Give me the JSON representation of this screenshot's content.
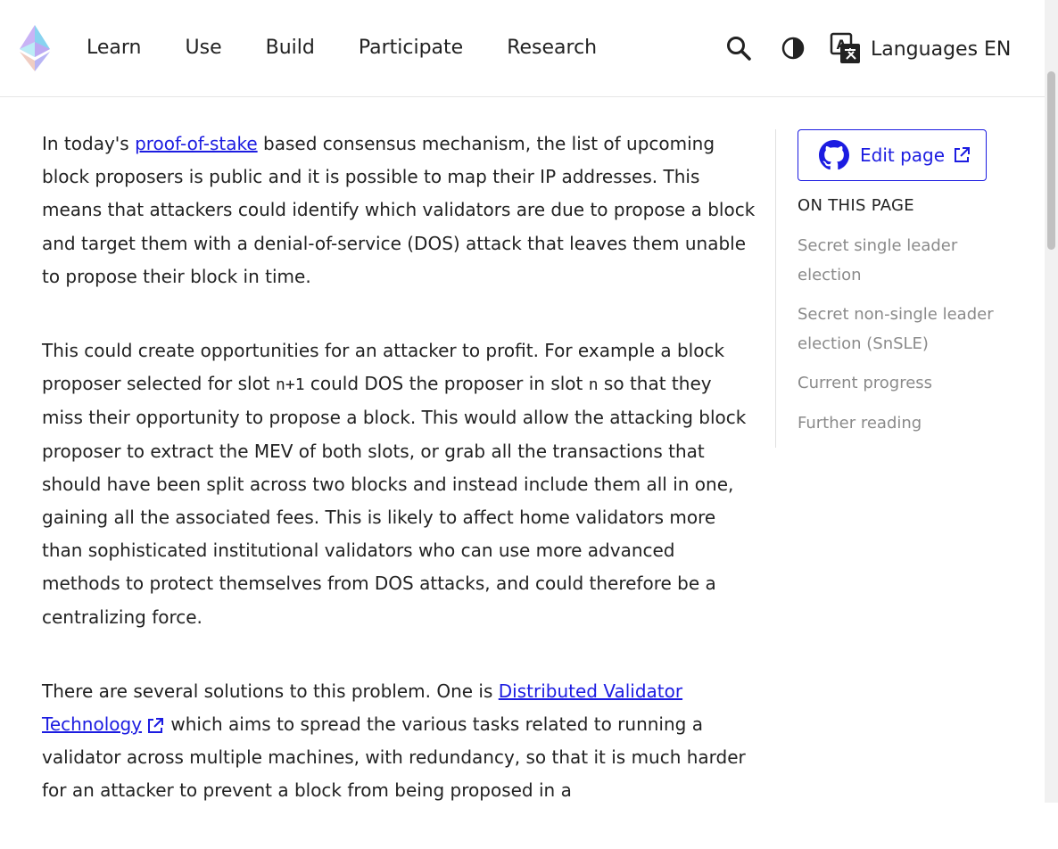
{
  "header": {
    "nav": [
      "Learn",
      "Use",
      "Build",
      "Participate",
      "Research"
    ],
    "icons": {
      "logo": "ethereum-logo",
      "search": "search-icon",
      "theme": "half-moon-icon",
      "language": "translate-icon"
    },
    "language_label": "Languages EN"
  },
  "content": {
    "p1": {
      "before": "In today's ",
      "link": "proof-of-stake",
      "after": " based consensus mechanism, the list of upcoming block proposers is public and it is possible to map their IP addresses. This means that attackers could identify which validators are due to propose a block and target them with a denial-of-service (DOS) attack that leaves them unable to propose their block in time."
    },
    "p2": {
      "part1": "This could create opportunities for an attacker to profit. For example a block proposer selected for slot ",
      "code1": "n+1",
      "part2": " could DOS the proposer in slot ",
      "code2": "n",
      "part3": " so that they miss their opportunity to propose a block. This would allow the attacking block proposer to extract the MEV of both slots, or grab all the transactions that should have been split across two blocks and instead include them all in one, gaining all the associated fees. This is likely to affect home validators more than sophisticated institutional validators who can use more advanced methods to protect themselves from DOS attacks, and could therefore be a centralizing force."
    },
    "p3": {
      "before": "There are several solutions to this problem. One is ",
      "link": "Distributed Validator Technology",
      "after": " which aims to spread the various tasks related to running a validator across multiple machines, with redundancy, so that it is much harder for an attacker to prevent a block from being proposed in a"
    }
  },
  "sidebar": {
    "edit_label": "Edit page",
    "toc_title": "ON THIS PAGE",
    "toc": [
      "Secret single leader election",
      "Secret non-single leader election (SnSLE)",
      "Current progress",
      "Further reading"
    ]
  },
  "colors": {
    "link": "#1c1ce1",
    "muted": "#8a8a8a",
    "text": "#222222"
  }
}
